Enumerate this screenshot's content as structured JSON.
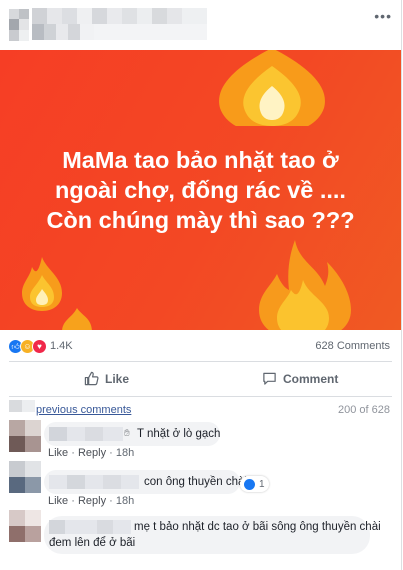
{
  "post": {
    "image_text_lines": [
      "MaMa tao bảo nhặt tao ở",
      "ngoài chợ, đống rác về ....",
      "Còn chúng mày thì sao ???"
    ],
    "more_label": "•••"
  },
  "reactions": {
    "count": "1.4K",
    "comments_count": "628 Comments"
  },
  "actions": {
    "like": "Like",
    "comment": "Comment"
  },
  "comments_header": {
    "previous": "previous comments",
    "count": "200 of 628"
  },
  "comments": [
    {
      "text": "T nhặt ở lò gạch",
      "meta_like": "Like",
      "meta_reply": "Reply",
      "meta_time": "18h",
      "reaction_count": ""
    },
    {
      "text": "con ông thuyền chài",
      "meta_like": "Like",
      "meta_reply": "Reply",
      "meta_time": "18h",
      "reaction_count": "1"
    },
    {
      "text_line1": "mẹ t bảo nhặt dc tao ở bãi sông ông thuyền chài",
      "text_line2": "đem lên để ở bãi",
      "meta_like": "Like",
      "meta_reply": "Reply",
      "meta_time": "18h"
    }
  ],
  "colors": {
    "image_bg": "#f5431f",
    "link": "#385898",
    "bubble": "#f2f3f5",
    "like_blue": "#1877f2"
  },
  "icons": [
    "more-icon",
    "like-thumb-icon",
    "comment-bubble-icon",
    "like-reaction-icon",
    "haha-reaction-icon",
    "love-reaction-icon",
    "fire-emoji-icon"
  ]
}
